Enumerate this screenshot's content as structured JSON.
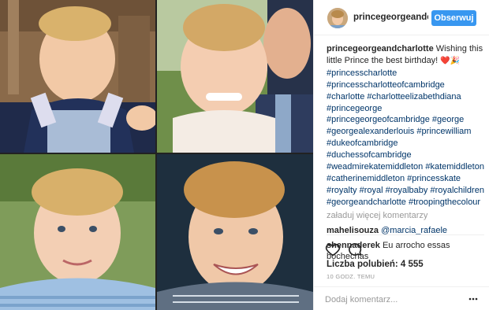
{
  "header": {
    "username": "princegeorgeandch",
    "follow_label": "Obserwuj"
  },
  "caption": {
    "author": "princegeorgeandcharlotte",
    "text": "Wishing this little Prince the best birthday!",
    "emoji": "❤️🎉",
    "hashtags": "#princesscharlotte #princesscharlotteofcambridge #charlotte #charlotteelizabethdiana #princegeorge #princegeorgeofcambridge #george #georgealexanderlouis #princewilliam #dukeofcambridge #duchessofcambridge #weadmirekatemiddleton #katemiddleton #catherinemiddleton #princesskate #royalty #royal #royalbaby #royalchildren #georgeandcharlotte #troopingthecolour"
  },
  "load_more": "załaduj więcej komentarzy",
  "comments": [
    {
      "author": "mahelisouza",
      "text": "@marcia_rafaele",
      "is_mention": true
    },
    {
      "author": "shennaderek",
      "text": "Eu arrocho essas bochechas",
      "is_mention": false
    }
  ],
  "likes": "Liczba polubień: 4 555",
  "timestamp": "10 GODZ. TEMU",
  "add_comment": {
    "placeholder": "Dodaj komentarz..."
  },
  "icons": {
    "like": "heart-icon",
    "comment": "comment-icon",
    "more": "more-options-icon"
  },
  "colors": {
    "accent": "#3897f0",
    "hashtag": "#003569",
    "muted": "#999999"
  }
}
